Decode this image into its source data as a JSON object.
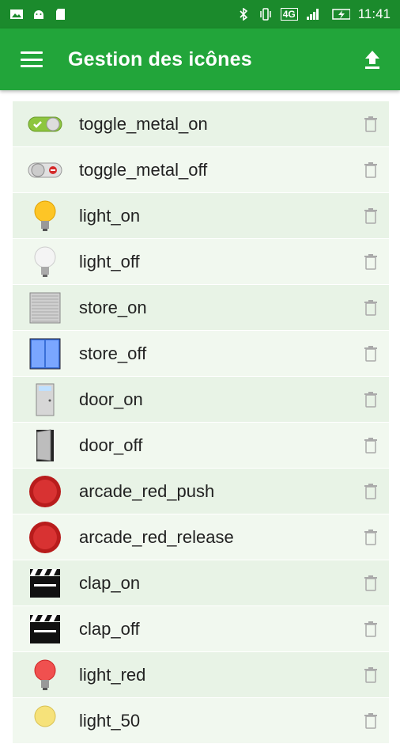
{
  "statusbar": {
    "time": "11:41",
    "network": "4G"
  },
  "appbar": {
    "title": "Gestion des icônes"
  },
  "icons": [
    {
      "name": "toggle_metal_on",
      "type": "toggle-on"
    },
    {
      "name": "toggle_metal_off",
      "type": "toggle-off"
    },
    {
      "name": "light_on",
      "type": "bulb-on"
    },
    {
      "name": "light_off",
      "type": "bulb-off"
    },
    {
      "name": "store_on",
      "type": "store-on"
    },
    {
      "name": "store_off",
      "type": "store-off"
    },
    {
      "name": "door_on",
      "type": "door-on"
    },
    {
      "name": "door_off",
      "type": "door-off"
    },
    {
      "name": "arcade_red_push",
      "type": "arcade"
    },
    {
      "name": "arcade_red_release",
      "type": "arcade"
    },
    {
      "name": "clap_on",
      "type": "clap"
    },
    {
      "name": "clap_off",
      "type": "clap"
    },
    {
      "name": "light_red",
      "type": "bulb-red"
    },
    {
      "name": "light_50",
      "type": "bulb-yellow"
    }
  ],
  "colors": {
    "statusbar": "#1b8a2c",
    "appbar": "#22a53a",
    "row_odd": "#e8f3e6",
    "row_even": "#f1f8ef"
  }
}
